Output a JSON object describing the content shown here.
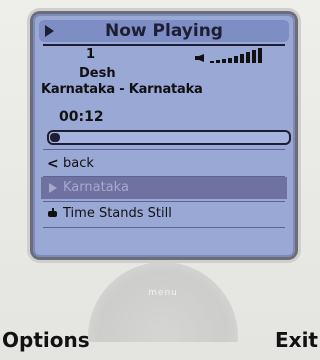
{
  "screen": {
    "title": "Now Playing",
    "track_number": "1",
    "artist": "Desh",
    "album": "Karnataka - Karnataka",
    "elapsed": "00:12",
    "progress_fraction": 0.04,
    "volume_level": "high"
  },
  "list": {
    "items": [
      {
        "label": "back",
        "icon": "back-arrow-icon"
      },
      {
        "label": "Karnataka",
        "icon": "play-icon",
        "selected": true
      },
      {
        "label": "Time Stands Still",
        "icon": "music-note-icon"
      }
    ]
  },
  "center": {
    "menu_label": "menu"
  },
  "softkeys": {
    "left": "Options",
    "right": "Exit"
  },
  "colors": {
    "screen_bg": "#9aa8d6",
    "title_bar": "#7e8ec4",
    "selection": "#6f72a0",
    "text": "#111111"
  }
}
